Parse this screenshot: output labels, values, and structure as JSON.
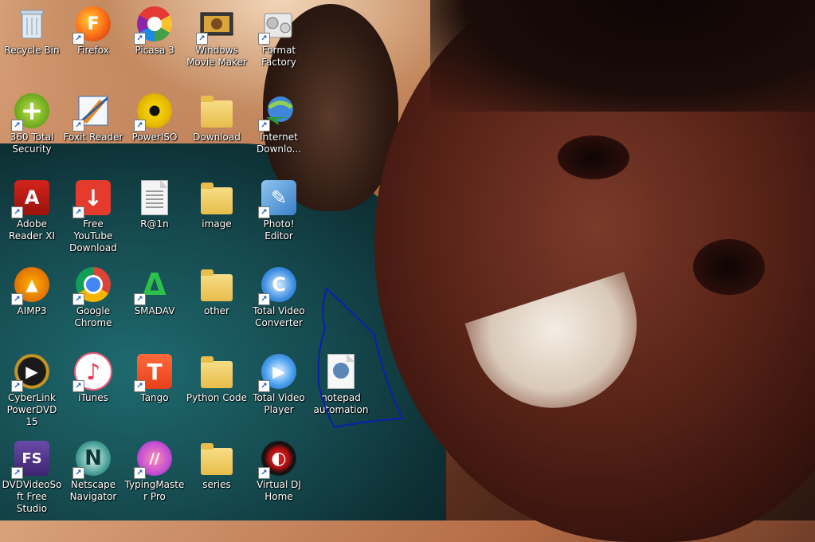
{
  "desktop": {
    "icons": [
      {
        "label": "Recycle Bin"
      },
      {
        "label": "Firefox"
      },
      {
        "label": "Picasa 3"
      },
      {
        "label": "Windows Movie Maker"
      },
      {
        "label": "Format Factory"
      },
      {
        "label": "360 Total Security"
      },
      {
        "label": "Foxit Reader"
      },
      {
        "label": "PowerISO"
      },
      {
        "label": "Download"
      },
      {
        "label": "Internet Downlo..."
      },
      {
        "label": "Adobe Reader XI"
      },
      {
        "label": "Free YouTube Download"
      },
      {
        "label": "R@1n"
      },
      {
        "label": "image"
      },
      {
        "label": "Photo! Editor"
      },
      {
        "label": "AIMP3"
      },
      {
        "label": "Google Chrome"
      },
      {
        "label": "SMADAV"
      },
      {
        "label": "other"
      },
      {
        "label": "Total Video Converter"
      },
      {
        "label": "CyberLink PowerDVD 15"
      },
      {
        "label": "iTunes"
      },
      {
        "label": "Tango"
      },
      {
        "label": "Python Code"
      },
      {
        "label": "Total Video Player"
      },
      {
        "label": "notepad automation"
      },
      {
        "label": "DVDVideoSoft Free Studio"
      },
      {
        "label": "Netscape Navigator"
      },
      {
        "label": "TypingMaster Pro"
      },
      {
        "label": "series"
      },
      {
        "label": "Virtual DJ Home"
      }
    ]
  },
  "glyphs": {
    "arrow": "↗",
    "plus": "+",
    "acrobat": "A",
    "down": "↓",
    "aimp": "▲",
    "smadav": "Δ",
    "cdvd": "▶",
    "note": "♪",
    "tango": "T",
    "fs": "FS",
    "netscape": "N",
    "typing": "//",
    "vdj": "◐",
    "ff": "F",
    "photo": "✎",
    "e": "e",
    "c": "C",
    "play": "▶"
  },
  "colors": {
    "label_text": "#ffffff",
    "annotation_stroke": "#0a1fb0"
  }
}
